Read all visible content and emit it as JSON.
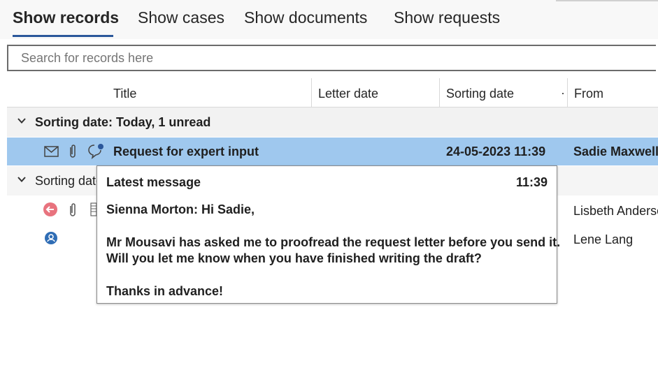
{
  "tabs": [
    {
      "label": "Show records",
      "active": true
    },
    {
      "label": "Show cases"
    },
    {
      "label": "Show documents"
    },
    {
      "label": "Show requests"
    }
  ],
  "search": {
    "placeholder": "Search for records here"
  },
  "columns": {
    "title": "Title",
    "letter_date": "Letter date",
    "sorting_date": "Sorting date",
    "from": "From"
  },
  "groups": [
    {
      "label": "Sorting date:  Today, 1 unread"
    },
    {
      "label": "Sorting date"
    }
  ],
  "rows": [
    {
      "title": "Request for expert input",
      "sorting_date": "24-05-2023 11:39",
      "from": "Sadie Maxwell",
      "icons": [
        "envelope-icon",
        "paperclip-icon",
        "comment-unread-icon"
      ]
    },
    {
      "from": "Lisbeth Andersen",
      "icons": [
        "return-arrow-icon",
        "paperclip-icon",
        "notebook-icon"
      ]
    },
    {
      "from": "Lene Lang",
      "icons": [
        "contact-icon"
      ]
    }
  ],
  "popup": {
    "title": "Latest message",
    "time": "11:39",
    "lines": [
      "Sienna Morton: Hi Sadie,",
      "Mr Mousavi has asked me to proofread the request letter before you send it.",
      "Will you let me know when you have finished writing the draft?",
      "Thanks in advance!"
    ]
  },
  "colors": {
    "accent": "#2b579a",
    "selection": "#9fc8ee",
    "return_icon": "#e8737e",
    "contact_icon": "#2f6db5"
  }
}
